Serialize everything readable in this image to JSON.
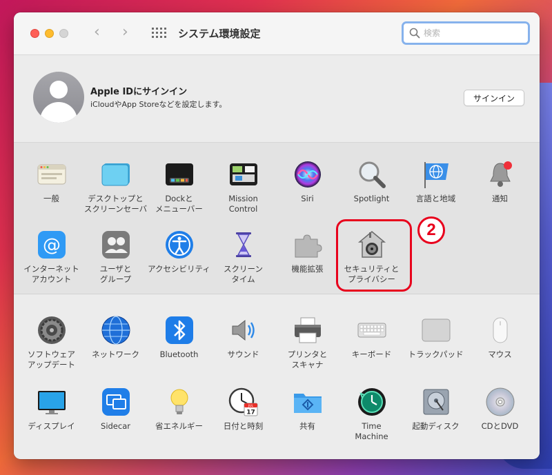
{
  "window": {
    "title": "システム環境設定",
    "search_placeholder": "検索"
  },
  "account": {
    "title": "Apple IDにサインイン",
    "subtitle": "iCloudやApp Storeなどを設定します。",
    "signin_label": "サインイン"
  },
  "section1": [
    {
      "label": "一般",
      "icon": "general-icon"
    },
    {
      "label": "デスクトップと\nスクリーンセーバ",
      "icon": "desktop-icon"
    },
    {
      "label": "Dockと\nメニューバー",
      "icon": "dock-icon"
    },
    {
      "label": "Mission\nControl",
      "icon": "mission-control-icon"
    },
    {
      "label": "Siri",
      "icon": "siri-icon"
    },
    {
      "label": "Spotlight",
      "icon": "spotlight-icon"
    },
    {
      "label": "言語と地域",
      "icon": "language-icon"
    },
    {
      "label": "通知",
      "icon": "notifications-icon"
    },
    {
      "label": "インターネット\nアカウント",
      "icon": "internet-accounts-icon"
    },
    {
      "label": "ユーザと\nグループ",
      "icon": "users-icon"
    },
    {
      "label": "アクセシビリティ",
      "icon": "accessibility-icon"
    },
    {
      "label": "スクリーン\nタイム",
      "icon": "screen-time-icon"
    },
    {
      "label": "機能拡張",
      "icon": "extensions-icon"
    },
    {
      "label": "セキュリティと\nプライバシー",
      "icon": "security-icon"
    }
  ],
  "section2": [
    {
      "label": "ソフトウェア\nアップデート",
      "icon": "software-update-icon"
    },
    {
      "label": "ネットワーク",
      "icon": "network-icon"
    },
    {
      "label": "Bluetooth",
      "icon": "bluetooth-icon"
    },
    {
      "label": "サウンド",
      "icon": "sound-icon"
    },
    {
      "label": "プリンタと\nスキャナ",
      "icon": "printer-icon"
    },
    {
      "label": "キーボード",
      "icon": "keyboard-icon"
    },
    {
      "label": "トラックパッド",
      "icon": "trackpad-icon"
    },
    {
      "label": "マウス",
      "icon": "mouse-icon"
    },
    {
      "label": "ディスプレイ",
      "icon": "display-icon"
    },
    {
      "label": "Sidecar",
      "icon": "sidecar-icon"
    },
    {
      "label": "省エネルギー",
      "icon": "energy-icon"
    },
    {
      "label": "日付と時刻",
      "icon": "date-time-icon"
    },
    {
      "label": "共有",
      "icon": "sharing-icon"
    },
    {
      "label": "Time\nMachine",
      "icon": "time-machine-icon"
    },
    {
      "label": "起動ディスク",
      "icon": "startup-disk-icon"
    },
    {
      "label": "CDとDVD",
      "icon": "cd-dvd-icon"
    }
  ],
  "date_icon": {
    "month": "JUL",
    "day": "17"
  },
  "annotation": {
    "step": "2",
    "color": "#e8001c"
  }
}
